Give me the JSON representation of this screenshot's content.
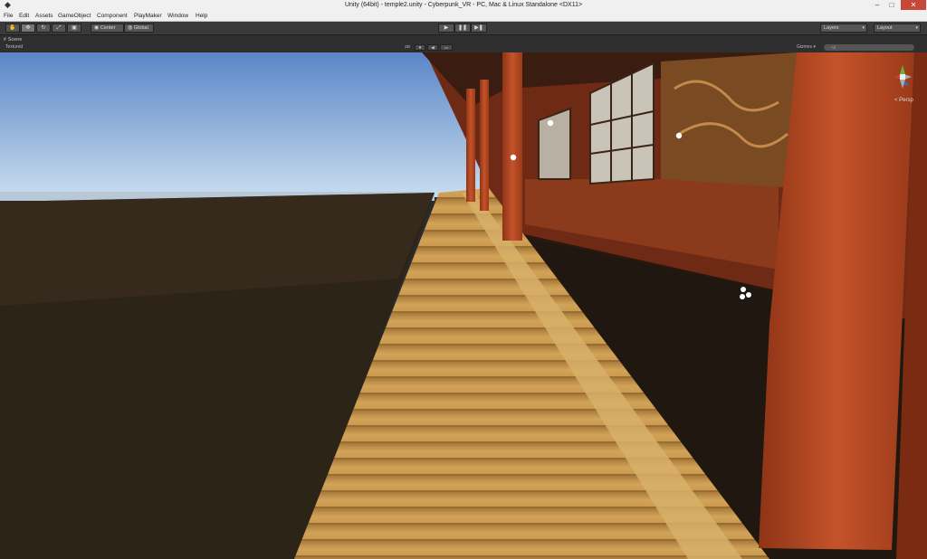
{
  "window": {
    "title": "Unity (64bit) - temple2.unity - Cyberpunk_VR - PC, Mac & Linux Standalone <DX11>",
    "minimize": "–",
    "maximize": "□",
    "close": "✕"
  },
  "menu": {
    "items": [
      "File",
      "Edit",
      "Assets",
      "GameObject",
      "Component",
      "PlayMaker",
      "Window",
      "Help"
    ]
  },
  "toolbar": {
    "tools": [
      "hand-icon",
      "move-icon",
      "rotate-icon",
      "scale-icon",
      "rect-icon"
    ],
    "pivot_label": "Center",
    "space_label": "Global",
    "play": "▶",
    "pause": "❚❚",
    "step": "▶❚",
    "layers_label": "Layers",
    "layout_label": "Layout"
  },
  "scene": {
    "tab_label": "Scene",
    "render_mode": "Textured",
    "btn_2d": "2D",
    "gizmos_label": "Gizmos",
    "search_placeholder": "All",
    "projection": "< Persp"
  },
  "colors": {
    "sky_top": "#5a86c7",
    "sky_bottom": "#c8dcef",
    "shadow_ground": "#2d2418",
    "plank": "#c99a4d",
    "pillar": "#b3451f",
    "toolbar_bg": "#3a3a3a"
  }
}
